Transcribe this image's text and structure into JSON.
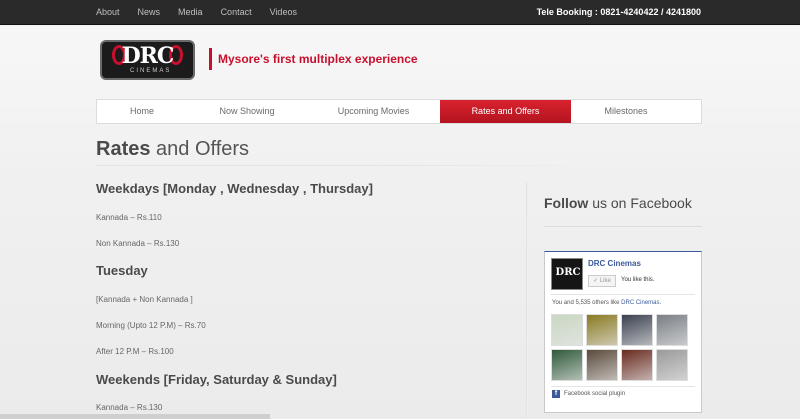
{
  "topbar": {
    "links": [
      "About",
      "News",
      "Media",
      "Contact",
      "Videos"
    ],
    "tele_booking": "Tele Booking : 0821-4240422 / 4241800"
  },
  "brand": {
    "logo_text": "DRC",
    "logo_sub": "CINEMAS",
    "tagline": "Mysore's first multiplex experience"
  },
  "nav": {
    "items": [
      {
        "label": "Home"
      },
      {
        "label": "Now Showing"
      },
      {
        "label": "Upcoming Movies"
      },
      {
        "label": "Rates and Offers",
        "active": true
      },
      {
        "label": "Milestones"
      }
    ]
  },
  "page": {
    "title_strong": "Rates",
    "title_rest": " and Offers"
  },
  "content": {
    "weekdays_heading": "Weekdays [Monday , Wednesday ,  Thursday]",
    "weekdays_kannada": "Kannada – Rs.110",
    "weekdays_non_kannada": "Non Kannada – Rs.130",
    "tuesday_heading": "Tuesday",
    "tuesday_note": "[Kannada + Non Kannada ]",
    "tuesday_morning": "Morning (Upto  12 P.M) – Rs.70",
    "tuesday_after": "After 12 P.M – Rs.100",
    "weekends_heading": "Weekends [Friday, Saturday & Sunday]",
    "weekends_kannada": "Kannada – Rs.130"
  },
  "sidebar": {
    "follow_strong": "Follow",
    "follow_rest": " us on Facebook",
    "fb": {
      "page_name": "DRC Cinemas",
      "like_label": "Like",
      "you_like": "You like this.",
      "count_prefix": "You and 5,535 others like ",
      "count_link": "DRC Cinemas.",
      "plugin_label": "Facebook social plugin",
      "face_colors": [
        "#c9d7c2",
        "#8a7a22",
        "#3b4150",
        "#7a7f86",
        "#2f5a3a",
        "#5a4a3a",
        "#6a2a1e",
        "#9a9a9a"
      ]
    }
  },
  "colors": {
    "accent_red": "#c8102e",
    "facebook_blue": "#3b5998",
    "topbar_bg": "#2a2a2a"
  }
}
